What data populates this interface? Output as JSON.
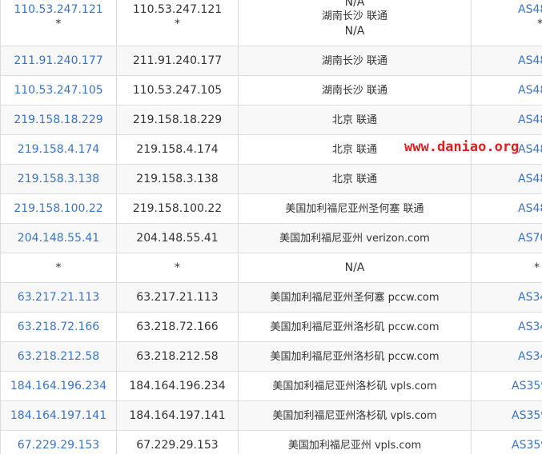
{
  "rows": [
    {
      "ip": "110.53.247.121",
      "ip2": "*",
      "host": "110.53.247.121",
      "host2": "*",
      "loc_top": "N/A",
      "loc": "湖南长沙 联通",
      "loc2": "N/A",
      "as": "AS48",
      "as2": "*"
    },
    {
      "ip": "211.91.240.177",
      "host": "211.91.240.177",
      "loc": "湖南长沙 联通",
      "as": "AS48"
    },
    {
      "ip": "110.53.247.105",
      "host": "110.53.247.105",
      "loc": "湖南长沙 联通",
      "as": "AS48"
    },
    {
      "ip": "219.158.18.229",
      "host": "219.158.18.229",
      "loc": "北京 联通",
      "as": "AS48"
    },
    {
      "ip": "219.158.4.174",
      "host": "219.158.4.174",
      "loc": "北京 联通",
      "as": "AS48"
    },
    {
      "ip": "219.158.3.138",
      "host": "219.158.3.138",
      "loc": "北京 联通",
      "as": "AS48"
    },
    {
      "ip": "219.158.100.22",
      "host": "219.158.100.22",
      "loc": "美国加利福尼亚州圣何塞 联通",
      "as": "AS48"
    },
    {
      "ip": "204.148.55.41",
      "host": "204.148.55.41",
      "loc": "美国加利福尼亚州 verizon.com",
      "as": "AS70"
    },
    {
      "ip": "*",
      "host": "*",
      "loc": "N/A",
      "as": "*"
    },
    {
      "ip": "63.217.21.113",
      "host": "63.217.21.113",
      "loc": "美国加利福尼亚州圣何塞 pccw.com",
      "as": "AS34"
    },
    {
      "ip": "63.218.72.166",
      "host": "63.218.72.166",
      "loc": "美国加利福尼亚州洛杉矶 pccw.com",
      "as": "AS34"
    },
    {
      "ip": "63.218.212.58",
      "host": "63.218.212.58",
      "loc": "美国加利福尼亚州洛杉矶 pccw.com",
      "as": "AS34"
    },
    {
      "ip": "184.164.196.234",
      "host": "184.164.196.234",
      "loc": "美国加利福尼亚州洛杉矶 vpls.com",
      "as": "AS359"
    },
    {
      "ip": "184.164.197.141",
      "host": "184.164.197.141",
      "loc": "美国加利福尼亚州洛杉矶 vpls.com",
      "as": "AS359"
    },
    {
      "ip": "67.229.29.153",
      "host": "67.229.29.153",
      "loc": "美国加利福尼亚州 vpls.com",
      "as": "AS359"
    }
  ],
  "watermark": "www.daniao.org",
  "colors": {
    "link": "#3a74c4",
    "watermark": "#e02020",
    "border": "#dcdcdc",
    "alt_row": "#f8f8f8"
  }
}
